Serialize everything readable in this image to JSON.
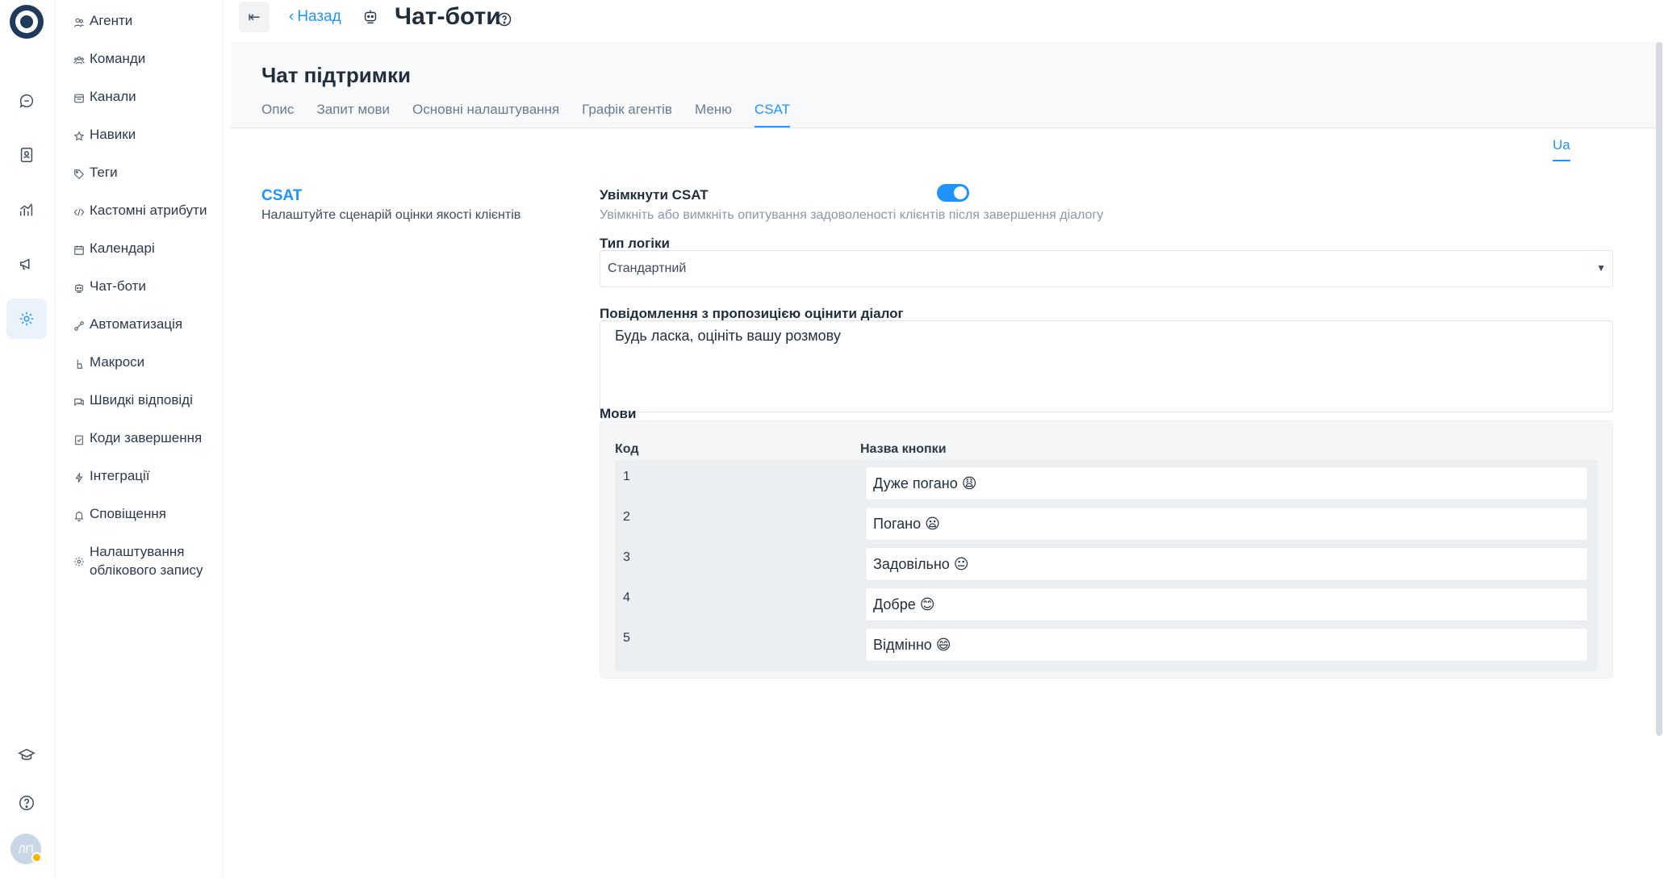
{
  "header": {
    "back_label": "Назад",
    "title": "Чат-боти"
  },
  "menu": {
    "items": [
      {
        "label": "Агенти",
        "icon": "agents-icon"
      },
      {
        "label": "Команди",
        "icon": "teams-icon"
      },
      {
        "label": "Канали",
        "icon": "channels-icon"
      },
      {
        "label": "Навики",
        "icon": "skills-icon"
      },
      {
        "label": "Теги",
        "icon": "tag-icon"
      },
      {
        "label": "Кастомні атрибути",
        "icon": "code-icon"
      },
      {
        "label": "Календарі",
        "icon": "calendar-icon"
      },
      {
        "label": "Чат-боти",
        "icon": "bot-icon"
      },
      {
        "label": "Автоматизація",
        "icon": "automation-icon"
      },
      {
        "label": "Макроси",
        "icon": "macros-icon"
      },
      {
        "label": "Швидкі відповіді",
        "icon": "quick-replies-icon"
      },
      {
        "label": "Коди завершення",
        "icon": "completion-codes-icon"
      },
      {
        "label": "Інтеграції",
        "icon": "integrations-icon"
      },
      {
        "label": "Сповіщення",
        "icon": "bell-icon"
      },
      {
        "label": "Налаштування облікового запису",
        "icon": "account-settings-icon"
      }
    ]
  },
  "user": {
    "initials": "ЛП",
    "status_color": "#f5b700"
  },
  "bot": {
    "name": "Чат підтримки"
  },
  "tabs": [
    "Опис",
    "Запит мови",
    "Основні налаштування",
    "Графік агентів",
    "Меню",
    "CSAT"
  ],
  "active_tab": "CSAT",
  "language_tab": "Ua",
  "section": {
    "title": "CSAT",
    "description": "Налаштуйте сценарій оцінки якості клієнтів"
  },
  "csat": {
    "enable_label": "Увімкнути CSAT",
    "enable_help": "Увімкніть або вимкніть опитування задоволеності клієнтів після завершення діалогу",
    "enabled": true,
    "logic_label": "Тип логіки",
    "logic_value": "Стандартний",
    "message_label": "Повідомлення з пропозицією оцінити діалог",
    "message_value": "Будь ласка, оцініть вашу розмову",
    "languages_label": "Мови",
    "col_code": "Код",
    "col_button": "Назва кнопки",
    "rows": [
      {
        "code": "1",
        "button": "Дуже погано 😩"
      },
      {
        "code": "2",
        "button": "Погано 😦"
      },
      {
        "code": "3",
        "button": "Задовільно 😐"
      },
      {
        "code": "4",
        "button": "Добре 😊"
      },
      {
        "code": "5",
        "button": "Відмінно 😄"
      }
    ]
  },
  "colors": {
    "accent": "#1f93ff",
    "text": "#1f2d3d",
    "muted": "#8a97a6"
  }
}
